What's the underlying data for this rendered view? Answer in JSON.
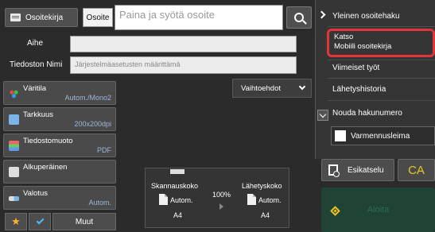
{
  "header": {
    "address_book_label": "Osoitekirja",
    "address_tab_label": "Osoite",
    "address_placeholder": "Paina ja syötä osoite"
  },
  "fields": {
    "subject_label": "Aihe",
    "subject_value": "",
    "filename_label": "Tiedoston Nimi",
    "filename_value": "Järjestelmäasetusten määrittämä"
  },
  "settings": [
    {
      "title": "Väritila",
      "value": "Autom./Mono2",
      "icon": "color-mode-icon"
    },
    {
      "title": "Tarkkuus",
      "value": "200x200dpi",
      "icon": "resolution-icon"
    },
    {
      "title": "Tiedostomuoto",
      "value": "PDF",
      "icon": "file-format-icon"
    },
    {
      "title": "Alkuperäinen",
      "value": "",
      "icon": "original-icon"
    },
    {
      "title": "Valotus",
      "value": "Autom.",
      "icon": "exposure-icon"
    }
  ],
  "options_label": "Vaihtoehdot",
  "scan": {
    "scan_size_label": "Skannauskoko",
    "send_size_label": "Lähetyskoko",
    "ratio": "100%",
    "scan_auto": "Autom.",
    "send_auto": "Autom.",
    "scan_paper": "A4",
    "send_paper": "A4"
  },
  "right_menu": {
    "items": [
      "Yleinen osoitehaku",
      "Katso",
      "Mobiili osoitekirja",
      "Viimeiset työt",
      "Lähetyshistoria",
      "Nouda hakunumero",
      "Varmennusleima"
    ]
  },
  "actions": {
    "preview_label": "Esikatselu",
    "ca_label": "CA",
    "start_label": "Aloita",
    "more_label": "Muut"
  },
  "colors": {
    "highlight": "#e3333b",
    "value_text": "#9fb6d8",
    "ca_text": "#e8c820",
    "start_bg": "#1f4436"
  }
}
